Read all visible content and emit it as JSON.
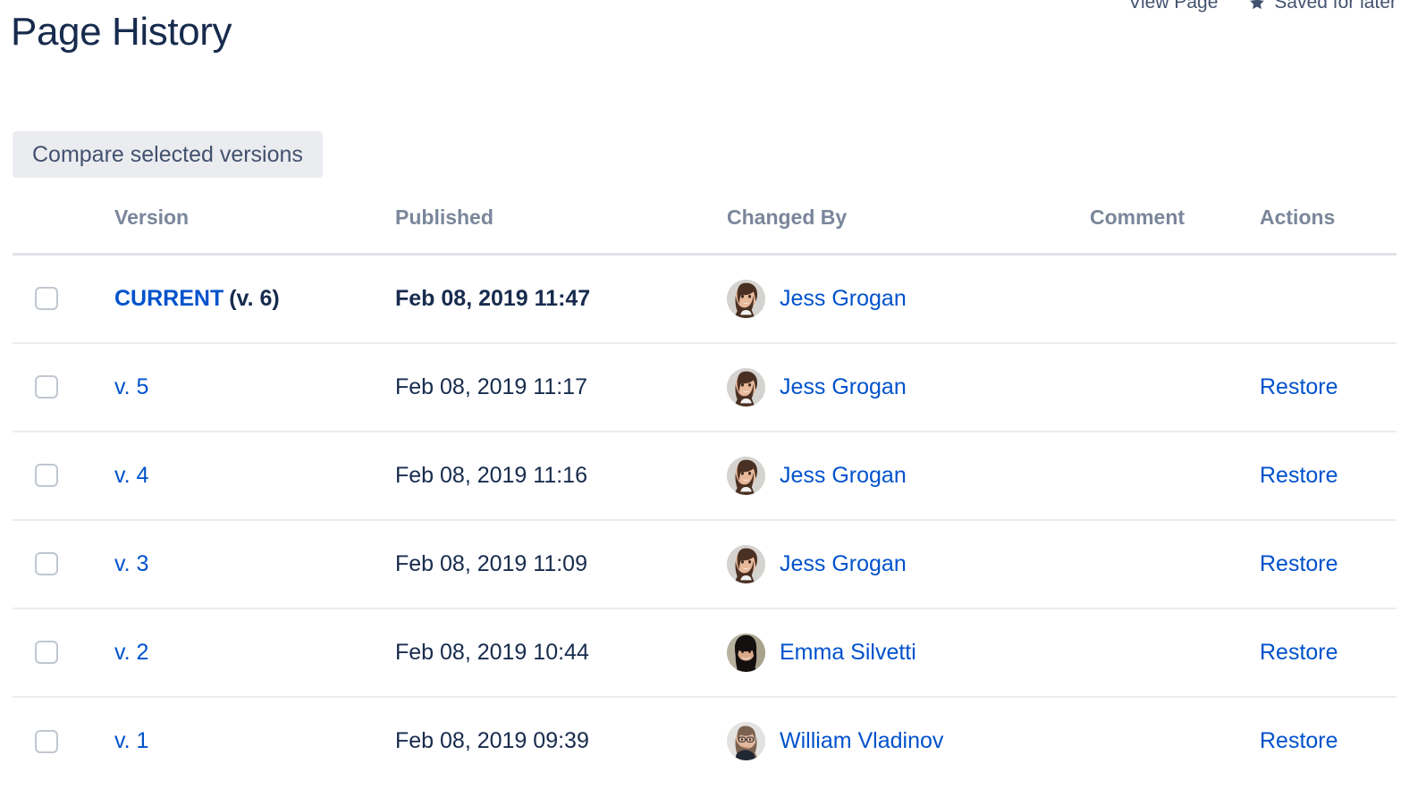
{
  "top_bar": {
    "view_page_label": "View Page",
    "saved_for_later_label": "Saved for later",
    "star_icon": "star-icon"
  },
  "page": {
    "title": "Page History"
  },
  "toolbar": {
    "compare_label": "Compare selected versions"
  },
  "table": {
    "columns": {
      "select": "",
      "version": "Version",
      "published": "Published",
      "changed_by": "Changed By",
      "comment": "Comment",
      "actions": "Actions"
    },
    "rows": [
      {
        "version_label": "CURRENT",
        "version_suffix": "(v. 6)",
        "is_current": true,
        "published": "Feb 08, 2019 11:47",
        "user": "Jess Grogan",
        "avatar": "avatar-jess-grogan",
        "comment": "",
        "action": ""
      },
      {
        "version_label": "v. 5",
        "version_suffix": "",
        "is_current": false,
        "published": "Feb 08, 2019 11:17",
        "user": "Jess Grogan",
        "avatar": "avatar-jess-grogan",
        "comment": "",
        "action": "Restore"
      },
      {
        "version_label": "v. 4",
        "version_suffix": "",
        "is_current": false,
        "published": "Feb 08, 2019 11:16",
        "user": "Jess Grogan",
        "avatar": "avatar-jess-grogan",
        "comment": "",
        "action": "Restore"
      },
      {
        "version_label": "v. 3",
        "version_suffix": "",
        "is_current": false,
        "published": "Feb 08, 2019 11:09",
        "user": "Jess Grogan",
        "avatar": "avatar-jess-grogan",
        "comment": "",
        "action": "Restore"
      },
      {
        "version_label": "v. 2",
        "version_suffix": "",
        "is_current": false,
        "published": "Feb 08, 2019 10:44",
        "user": "Emma Silvetti",
        "avatar": "avatar-emma-silvetti",
        "comment": "",
        "action": "Restore"
      },
      {
        "version_label": "v. 1",
        "version_suffix": "",
        "is_current": false,
        "published": "Feb 08, 2019 09:39",
        "user": "William Vladinov",
        "avatar": "avatar-william-vladinov",
        "comment": "",
        "action": "Restore"
      }
    ]
  },
  "colors": {
    "link": "#0052CC",
    "text": "#172B4D",
    "muted_header": "#7A869A",
    "button_bg": "#EBECF0",
    "row_divider": "#EBECF0",
    "header_divider": "#DFE1E6"
  }
}
